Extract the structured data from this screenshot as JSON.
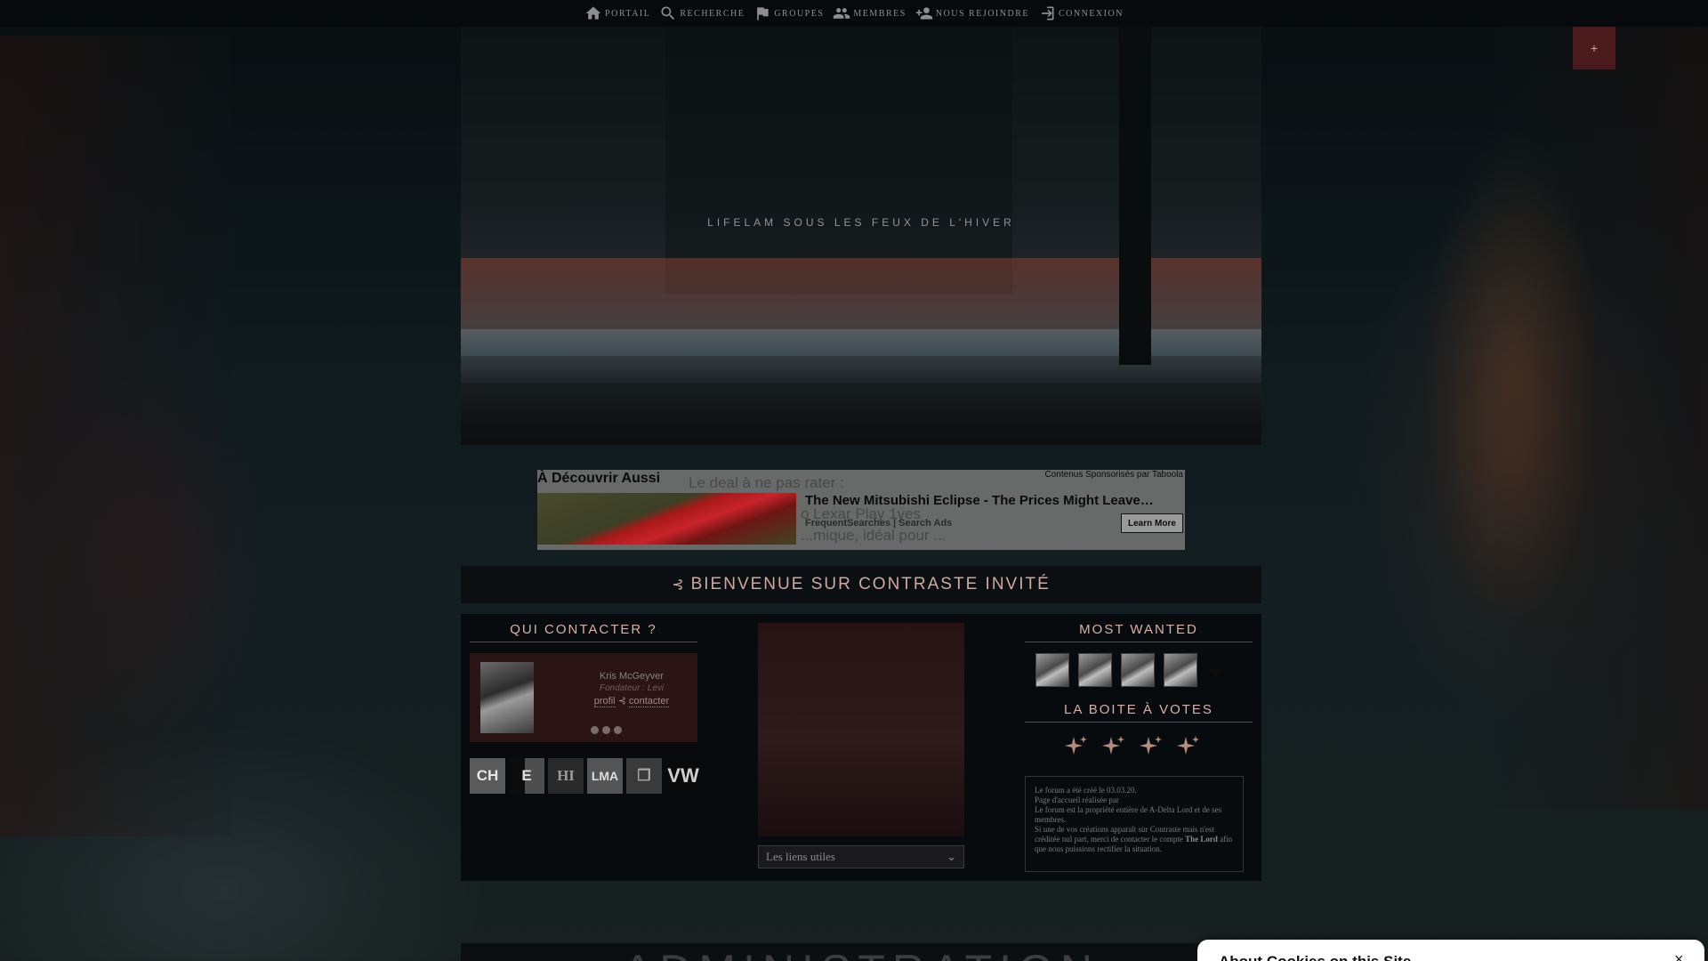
{
  "nav": {
    "items": [
      {
        "label": "PORTAIL",
        "icon": "home-icon"
      },
      {
        "label": "RECHERCHE",
        "icon": "search-icon"
      },
      {
        "label": "GROUPES",
        "icon": "flag-icon"
      },
      {
        "label": "MEMBRES",
        "icon": "users-icon"
      },
      {
        "label": "NOUS REJOINDRE",
        "icon": "person-add-icon"
      },
      {
        "label": "CONNEXION",
        "icon": "login-icon"
      }
    ]
  },
  "corner_button": {
    "label": "+"
  },
  "banner": {
    "title": "LIFELAM SOUS LES FEUX DE L'HIVER"
  },
  "ad": {
    "heading": "À Découvrir Aussi",
    "sponsor": "Contenus Sponsorisés par Taboola",
    "title": "The New Mitsubishi Eclipse - The Prices Might Leave…",
    "source": "FrequentSearches | Search Ads",
    "cta": "Learn More",
    "ghost_1": "Le deal à ne pas rater :",
    "ghost_2": "o Lexar Play 1yes",
    "ghost_3": "...mique, idéal pour ..."
  },
  "welcome": {
    "separator": "⊰",
    "text": "BIENVENUE SUR CONTRASTE INVITÉ"
  },
  "contact": {
    "title": "QUI CONTACTER ?",
    "name": "Kris McGeyver",
    "role": "Fondateur : Levi",
    "link_profile": "profil",
    "link_sep": "⊰",
    "link_contact": "contacter",
    "partners": [
      "CH",
      "E",
      "HI",
      "LMA",
      "❒",
      "VW"
    ]
  },
  "links_select": {
    "value": "Les liens utiles",
    "arrow": "⌄"
  },
  "wanted": {
    "title": "MOST WANTED",
    "plus": "+"
  },
  "votes": {
    "title": "LA BOITE À VOTES"
  },
  "credits": {
    "line1": "Le forum a été créé le 03.03.20.",
    "line2": "Page d'accueil réalisée par",
    "line3": "Le forum est la propriété entière de A-Delta Lord et de ses membres.",
    "line4": "Si une de vos créations apparaît sur Contraste mais n'est créditée nul part, merci de contacter le compte",
    "line4_bold": "The Lord",
    "line5": "afin que nous puissions rectifier la situation."
  },
  "admin": {
    "title": "ADMINISTRATION"
  },
  "cookie": {
    "title": "About Cookies on this Site",
    "close": "×"
  }
}
